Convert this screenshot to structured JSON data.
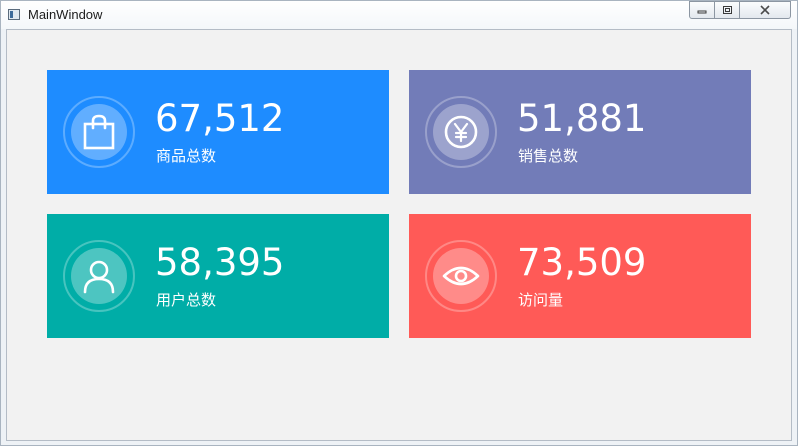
{
  "window": {
    "title": "MainWindow"
  },
  "cards": [
    {
      "value": "67,512",
      "label": "商品总数",
      "color": "#1e8cff",
      "icon": "shopping-bag-icon"
    },
    {
      "value": "51,881",
      "label": "销售总数",
      "color": "#727cb8",
      "icon": "yen-icon"
    },
    {
      "value": "58,395",
      "label": "用户总数",
      "color": "#00ada7",
      "icon": "user-icon"
    },
    {
      "value": "73,509",
      "label": "访问量",
      "color": "#ff5a57",
      "icon": "eye-icon"
    }
  ]
}
